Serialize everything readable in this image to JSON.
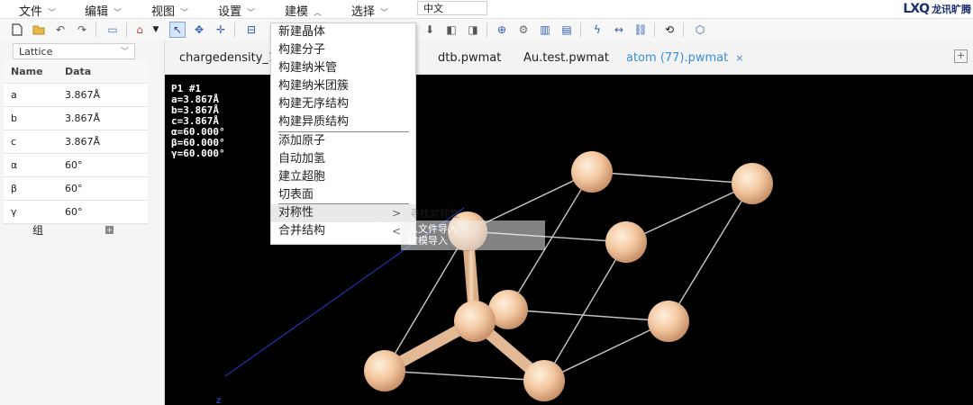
{
  "menubar": {
    "items": [
      {
        "label": "文件",
        "open": false
      },
      {
        "label": "编辑",
        "open": false
      },
      {
        "label": "视图",
        "open": false
      },
      {
        "label": "设置",
        "open": false
      },
      {
        "label": "建模",
        "open": true
      },
      {
        "label": "选择",
        "open": false
      }
    ],
    "language": "中文",
    "brand": {
      "mark": "LXQ",
      "text": "龙讯旷腾"
    }
  },
  "toolbar": {
    "icons": [
      "new-file-icon",
      "open-folder-icon",
      "undo-icon",
      "redo-icon",
      "monitor-icon",
      "home-icon",
      "select-arrow-icon",
      "rotate-icon",
      "move-icon",
      "measure-icon",
      "import-icon",
      "back-icon",
      "forward-icon",
      "add-atom-icon",
      "settings-gear-icon",
      "bond-icon",
      "clipboard-icon",
      "bond-link-icon",
      "distance-icon",
      "link-icon",
      "loop-icon",
      "cube-icon"
    ]
  },
  "left_panel": {
    "select_value": "Lattice",
    "table": {
      "headers": [
        "Name",
        "Data"
      ],
      "rows": [
        [
          "a",
          "3.867Å"
        ],
        [
          "b",
          "3.867Å"
        ],
        [
          "c",
          "3.867Å"
        ],
        [
          "α",
          "60°"
        ],
        [
          "β",
          "60°"
        ],
        [
          "γ",
          "60°"
        ]
      ]
    },
    "group_label": "组",
    "group_add": "+"
  },
  "tabs": [
    {
      "label": "chargedensity_1 (1",
      "active": false
    },
    {
      "label": "dtb.pwmat",
      "active": false
    },
    {
      "label": "Au.test.pwmat",
      "active": false
    },
    {
      "label": "atom (77).pwmat",
      "active": true
    }
  ],
  "tab_close": "×",
  "tab_add": "+",
  "viewport": {
    "info_lines": [
      "P1 #1",
      "a=3.867Å",
      "b=3.867Å",
      "c=3.867Å",
      "α=60.000°",
      "β=60.000°",
      "γ=60.000°"
    ],
    "axis_z": "z",
    "atom_color": "#f2c7a0",
    "bond_color": "#e9c9a7",
    "edge_color": "#c8c8c8"
  },
  "dropdown": {
    "items": [
      {
        "label": "新建晶体"
      },
      {
        "label": "构建分子"
      },
      {
        "label": "构建纳米管"
      },
      {
        "label": "构建纳米团簇"
      },
      {
        "label": "构建无序结构"
      },
      {
        "label": "构建异质结构"
      },
      {
        "label": "添加原子"
      },
      {
        "label": "自动加氢"
      },
      {
        "label": "建立超胞"
      },
      {
        "label": "切表面"
      },
      {
        "label": "对称性",
        "arrow": ">"
      },
      {
        "label": "合并结构",
        "arrow": "<"
      }
    ]
  },
  "submenu": {
    "items": [
      "从文件导入",
      "建模导入"
    ],
    "ghost": "寻找对称性"
  }
}
